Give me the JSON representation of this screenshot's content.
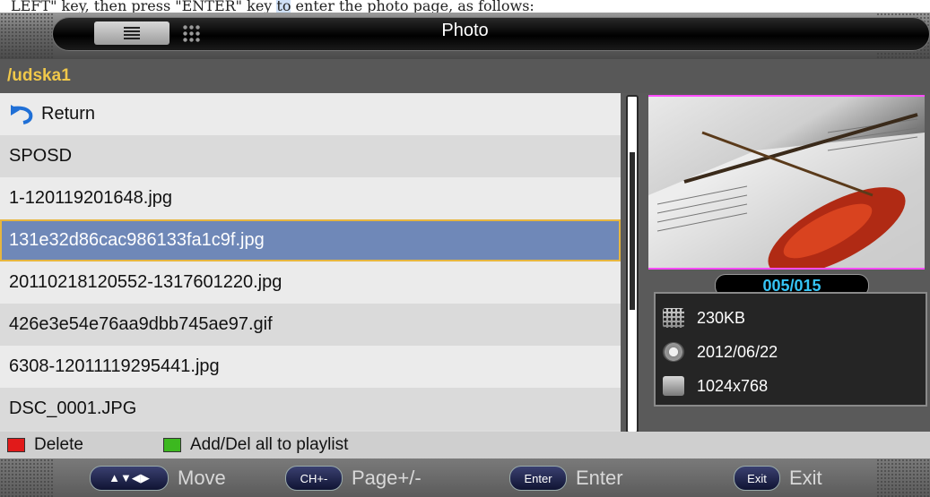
{
  "doc_text": {
    "before": "LEFT\" key, then press \"ENTER\" key ",
    "highlight": "to",
    " after": "",
    "after": " enter the photo page, as follows:"
  },
  "header": {
    "title": "Photo",
    "list_view_icon": "list-icon",
    "grid_view_icon": "grid-icon"
  },
  "path": {
    "label": "/udska1"
  },
  "files": {
    "items": [
      {
        "label": "Return",
        "icon": "return-icon"
      },
      {
        "label": "SPOSD"
      },
      {
        "label": "1-120119201648.jpg"
      },
      {
        "label": "131e32d86cac986133fa1c9f.jpg",
        "selected": true
      },
      {
        "label": "20110218120552-1317601220.jpg"
      },
      {
        "label": "426e3e54e76aa9dbb745ae97.gif"
      },
      {
        "label": "6308-12011119295441.jpg"
      },
      {
        "label": "DSC_0001.JPG"
      }
    ]
  },
  "preview": {
    "counter": "005/015"
  },
  "info": {
    "size": "230KB",
    "date": "2012/06/22",
    "resolution": "1024x768"
  },
  "keys": {
    "red_label": "Delete",
    "red_color": "#e11a1a",
    "green_label": "Add/Del all to playlist",
    "green_color": "#3cb81f"
  },
  "help": {
    "move_cap": "▲▼◀▶",
    "move_label": "Move",
    "page_cap": "CH+-",
    "page_label": "Page+/-",
    "enter_cap": "Enter",
    "enter_label": "Enter",
    "exit_cap": "Exit",
    "exit_label": "Exit"
  },
  "colors": {
    "selection": "#6f88b8",
    "selection_border": "#e7b63f",
    "path_text": "#f0c84a",
    "counter_text": "#35c4f5"
  }
}
